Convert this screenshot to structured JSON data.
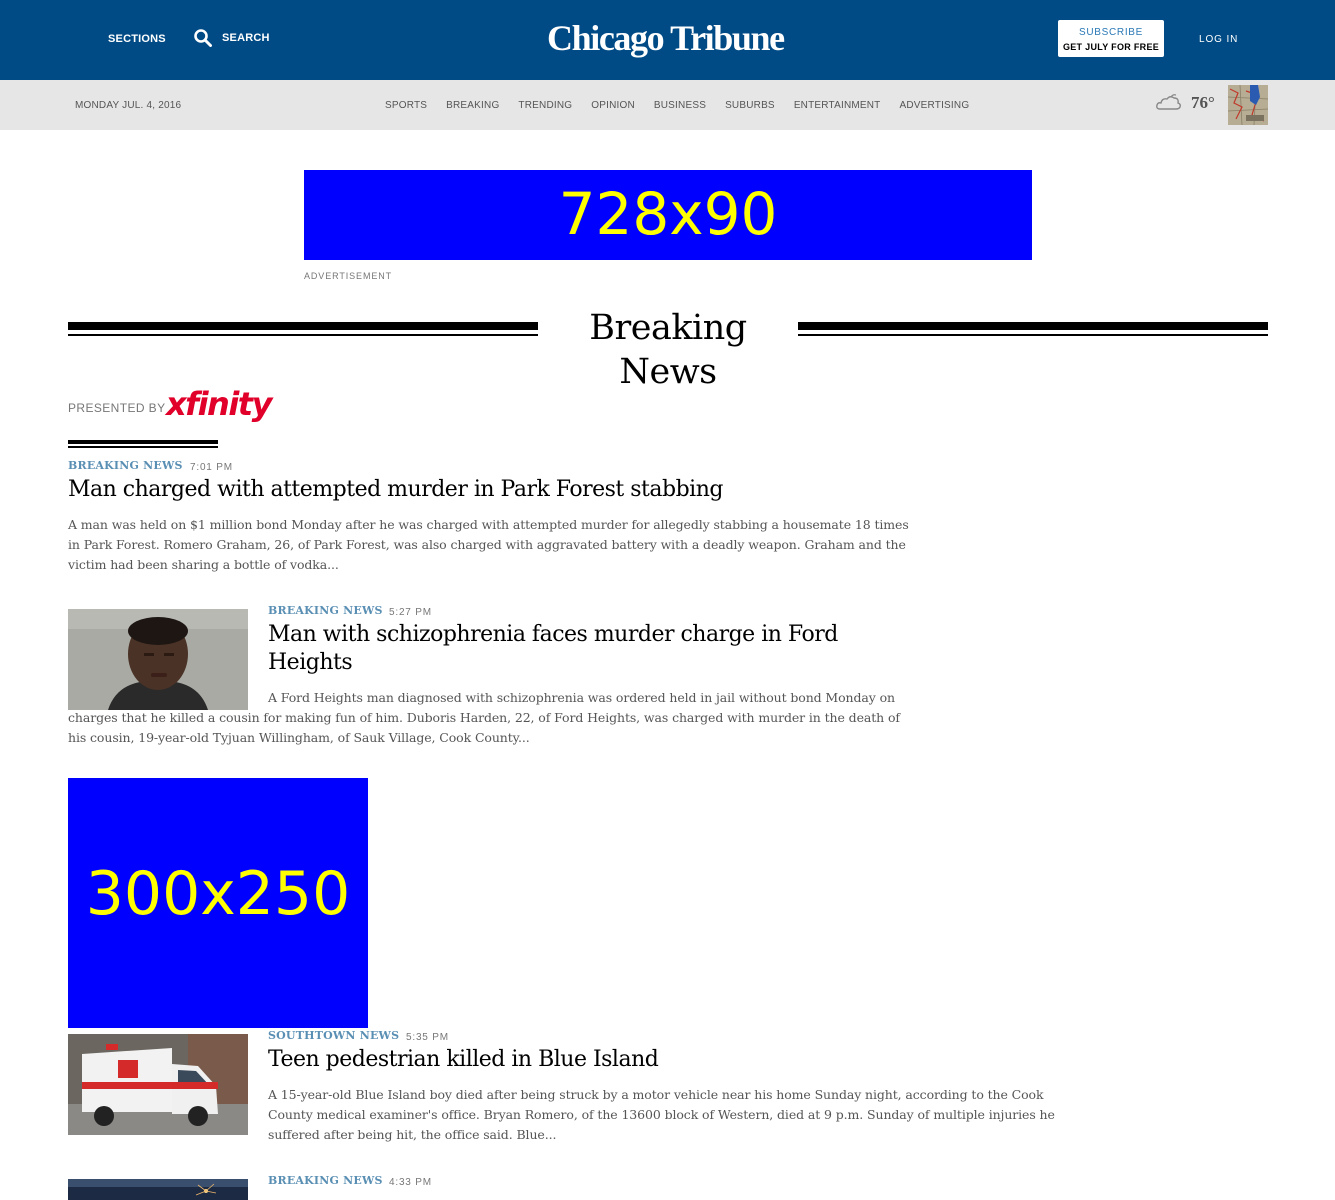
{
  "header": {
    "sections_label": "SECTIONS",
    "search_label": "SEARCH",
    "logo_text": "Chicago Tribune",
    "subscribe_top": "SUBSCRIBE",
    "subscribe_bottom": "GET JULY FOR FREE",
    "login_label": "LOG IN"
  },
  "navbar": {
    "date": "MONDAY JUL. 4, 2016",
    "links": [
      "SPORTS",
      "BREAKING",
      "TRENDING",
      "OPINION",
      "BUSINESS",
      "SUBURBS",
      "ENTERTAINMENT",
      "ADVERTISING"
    ],
    "temperature": "76°",
    "weather_icon": "cloud-icon"
  },
  "ads": {
    "leaderboard": "728x90",
    "label": "ADVERTISEMENT",
    "box": "300x250"
  },
  "section": {
    "title": "Breaking News",
    "presented_by": "PRESENTED BY",
    "sponsor": "xfinity"
  },
  "stories": [
    {
      "label": "BREAKING NEWS",
      "time": "7:01 PM",
      "headline": "Man charged with attempted murder in Park Forest stabbing",
      "summary": "A man was held on $1 million bond Monday after he was charged with attempted murder for allegedly stabbing a housemate 18 times in Park Forest. Romero Graham, 26, of Park Forest, was also charged with aggravated battery with a deadly weapon. Graham and the victim had been sharing a bottle of vodka..."
    },
    {
      "label": "BREAKING NEWS",
      "time": "5:27 PM",
      "headline": "Man with schizophrenia faces murder charge in Ford Heights",
      "summary": "A Ford Heights man diagnosed with schizophrenia was ordered held in jail without bond Monday on charges that he killed a cousin for making fun of him. Duboris Harden, 22, of Ford Heights, was charged with murder in the death of his cousin, 19-year-old Tyjuan Willingham, of Sauk Village, Cook County..."
    },
    {
      "label": "SOUTHTOWN NEWS",
      "time": "5:35 PM",
      "headline": "Teen pedestrian killed in Blue Island",
      "summary": "A 15-year-old Blue Island boy died after being struck by a motor vehicle near his home Sunday night, according to the Cook County medical examiner's office. Bryan Romero, of the 13600 block of Western, died at 9 p.m. Sunday of multiple injuries he suffered after being hit, the office said. Blue..."
    },
    {
      "label": "BREAKING NEWS",
      "time": "4:33 PM",
      "headline": ""
    }
  ],
  "colors": {
    "header_bg": "#004b85",
    "nav_bg": "#e6e6e6",
    "story_label": "#5a8fb4",
    "ad_bg": "#0000ff",
    "ad_text": "#ffff00",
    "sponsor_red": "#e0002a"
  }
}
